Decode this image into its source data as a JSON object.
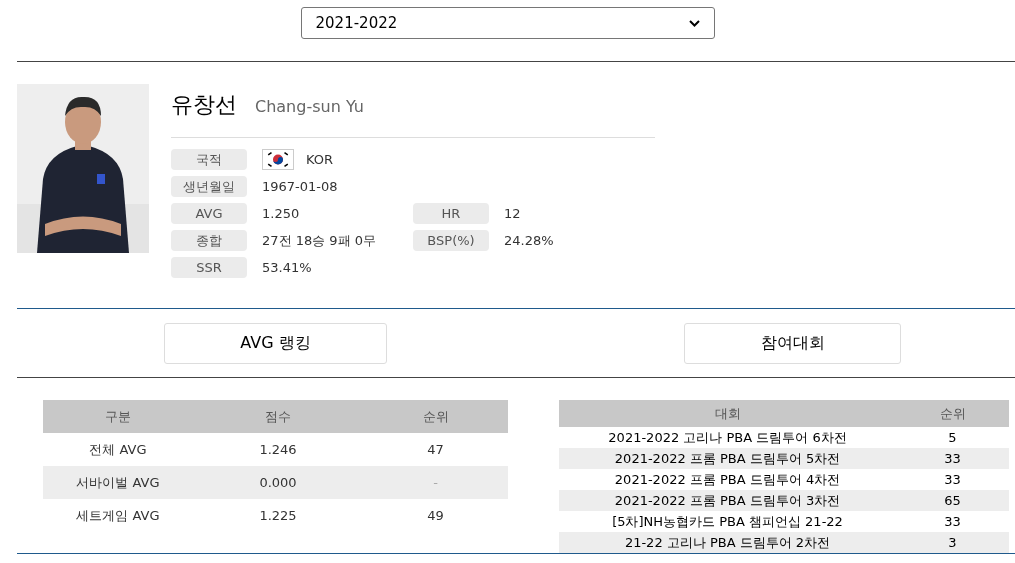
{
  "season_select": {
    "value": "2021-2022"
  },
  "player": {
    "name_ko": "유창선",
    "name_en": "Chang-sun Yu",
    "info": [
      {
        "label": "국적",
        "value": "KOR",
        "kind": "flag"
      },
      {
        "label": "생년월일",
        "value": "1967-01-08"
      },
      {
        "label": "AVG",
        "value": "1.250",
        "label2": "HR",
        "value2": "12"
      },
      {
        "label": "종합",
        "value": "27전 18승 9패 0무",
        "label2": "BSP(%)",
        "value2": "24.28%"
      },
      {
        "label": "SSR",
        "value": "53.41%"
      }
    ]
  },
  "tabs": [
    {
      "label": "AVG 랭킹"
    },
    {
      "label": "참여대회"
    }
  ],
  "avg_table": {
    "columns": [
      "구분",
      "점수",
      "순위"
    ],
    "rows": [
      [
        "전체 AVG",
        "1.246",
        "47"
      ],
      [
        "서바이벌 AVG",
        "0.000",
        "-"
      ],
      [
        "세트게임 AVG",
        "1.225",
        "49"
      ]
    ]
  },
  "tournament_table": {
    "columns": [
      "대회",
      "순위"
    ],
    "rows": [
      [
        "2021-2022 고리나 PBA 드림투어 6차전",
        "5"
      ],
      [
        "2021-2022 프롬 PBA 드림투어 5차전",
        "33"
      ],
      [
        "2021-2022 프롬 PBA 드림투어 4차전",
        "33"
      ],
      [
        "2021-2022 프롬 PBA 드림투어 3차전",
        "65"
      ],
      [
        "[5차]NH농협카드 PBA 챔피언십 21-22",
        "33"
      ],
      [
        "21-22 고리나 PBA 드림투어 2차전",
        "3"
      ]
    ]
  }
}
